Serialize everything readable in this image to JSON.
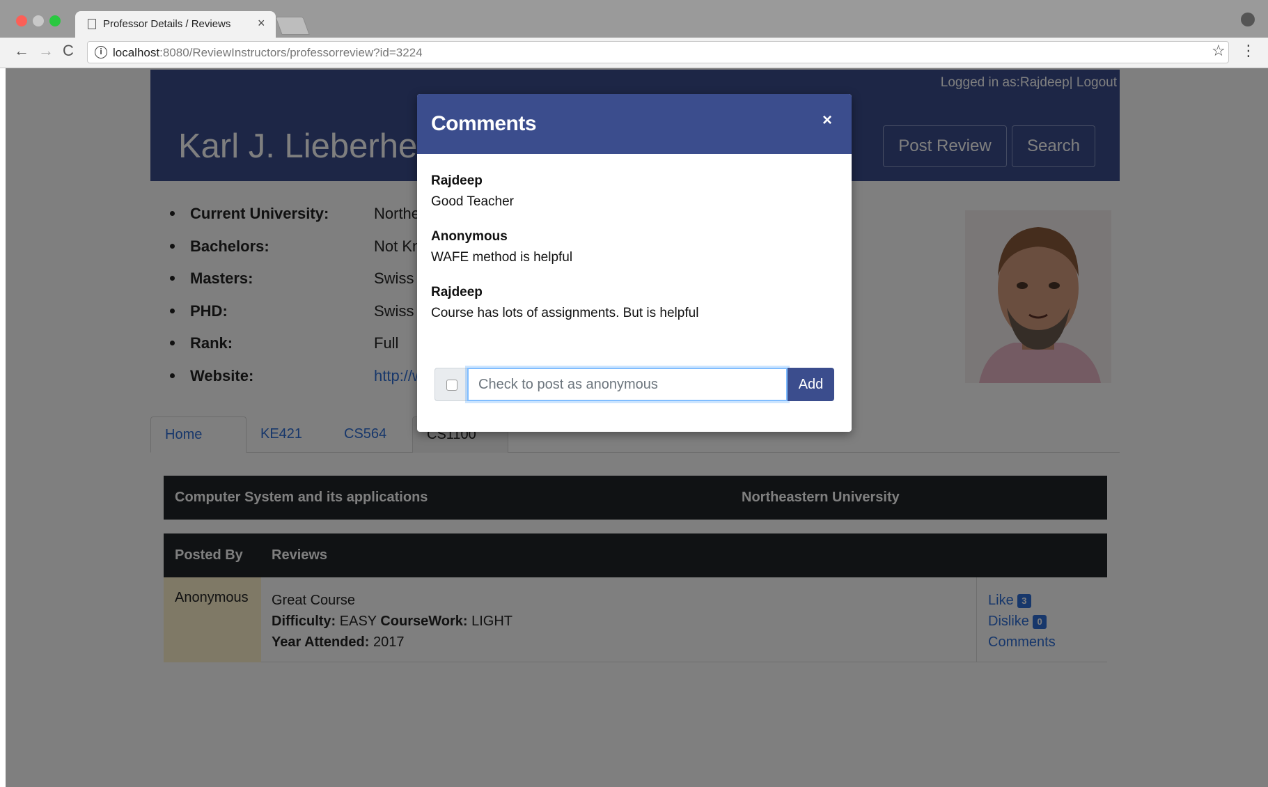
{
  "browser": {
    "tab_title": "Professor Details / Reviews",
    "tab_close": "×",
    "url_host": "localhost",
    "url_rest": ":8080/ReviewInstructors/professorreview?id=3224",
    "info_glyph": "i",
    "back_glyph": "←",
    "forward_glyph": "→",
    "reload_glyph": "C",
    "star_glyph": "☆",
    "menu_glyph": "⋮"
  },
  "header": {
    "login_text": "Logged in as:Rajdeep| Logout",
    "professor_name": "Karl J. Lieberherr",
    "post_review_label": "Post Review",
    "search_label": "Search"
  },
  "details": [
    {
      "label": "Current University:",
      "value": "Northeastern University"
    },
    {
      "label": "Bachelors:",
      "value": "Not Known"
    },
    {
      "label": "Masters:",
      "value": "Swiss Federal Institute of Technology"
    },
    {
      "label": "PHD:",
      "value": "Swiss Federal Institute of Technology"
    },
    {
      "label": "Rank:",
      "value": "Full"
    },
    {
      "label": "Website:",
      "value": "http://www.ccs.neu.edu/home/lieber"
    }
  ],
  "course_tabs": [
    "Home",
    "KE421",
    "CS564",
    "CS1100"
  ],
  "course_bar": {
    "course_name": "Computer System and its applications",
    "university": "Northeastern University"
  },
  "reviews_table": {
    "headers": [
      "Posted By",
      "Reviews"
    ],
    "rows": [
      {
        "posted_by": "Anonymous",
        "review": "Great Course",
        "difficulty_label": "Difficulty:",
        "difficulty": "EASY",
        "coursework_label": "CourseWork:",
        "coursework": "LIGHT",
        "year_label": "Year Attended:",
        "year": "2017",
        "like_label": "Like",
        "like_count": "3",
        "dislike_label": "Dislike",
        "dislike_count": "0",
        "comments_label": "Comments"
      }
    ]
  },
  "modal": {
    "title": "Comments",
    "close_glyph": "×",
    "comments": [
      {
        "author": "Rajdeep",
        "text": "Good Teacher"
      },
      {
        "author": "Anonymous",
        "text": "WAFE method is helpful"
      },
      {
        "author": "Rajdeep",
        "text": "Course has lots of assignments. But is helpful"
      }
    ],
    "input_placeholder": "Check to post as anonymous",
    "input_value": "",
    "add_label": "Add"
  },
  "colors": {
    "brand_navy": "#3b4d8d",
    "link_blue": "#2f6fd6",
    "table_dark": "#212529",
    "poster_highlight": "#fff3cd"
  }
}
